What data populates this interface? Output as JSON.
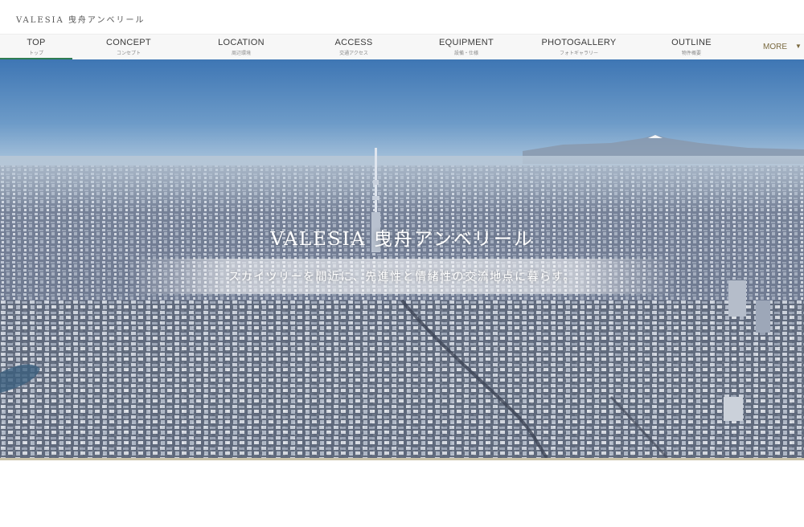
{
  "header": {
    "logo": "VALESIA 曳舟アンベリール"
  },
  "nav": {
    "items": [
      {
        "en": "TOP",
        "jp": "トップ",
        "active": true
      },
      {
        "en": "CONCEPT",
        "jp": "コンセプト"
      },
      {
        "en": "LOCATION",
        "jp": "周辺環境"
      },
      {
        "en": "ACCESS",
        "jp": "交通アクセス"
      },
      {
        "en": "EQUIPMENT",
        "jp": "設備・仕様"
      },
      {
        "en": "PHOTOGALLERY",
        "jp": "フォトギャラリー"
      },
      {
        "en": "OUTLINE",
        "jp": "物件概要"
      }
    ],
    "more": "MORE",
    "active_color": "#2f7d52"
  },
  "hero": {
    "title": "VALESIA 曳舟アンベリール",
    "tagline": "スカイツリーを間近に、先進性と情緒性の交流地点に暮らす。"
  }
}
